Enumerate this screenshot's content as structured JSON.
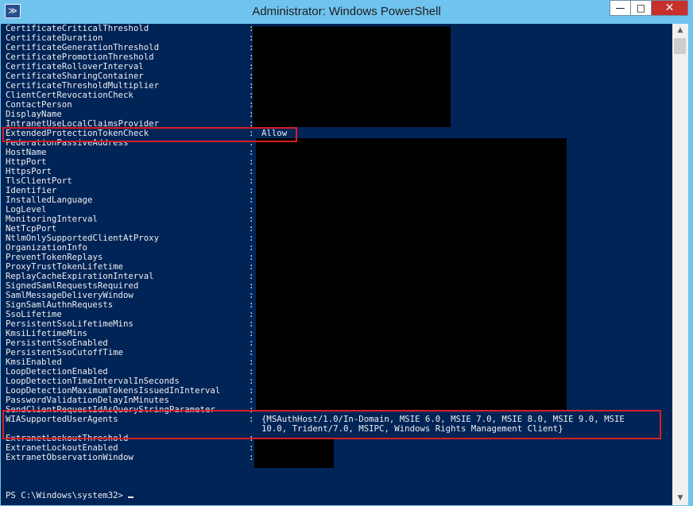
{
  "window": {
    "title": "Administrator: Windows PowerShell",
    "app_icon": "powershell-icon",
    "app_icon_glyph": "≫",
    "controls": {
      "minimize": "—",
      "maximize": "□",
      "close": "✕"
    }
  },
  "console": {
    "lines": [
      {
        "label": "CertificateCriticalThreshold",
        "sep": ":",
        "value": ""
      },
      {
        "label": "CertificateDuration",
        "sep": ":",
        "value": ""
      },
      {
        "label": "CertificateGenerationThreshold",
        "sep": ":",
        "value": ""
      },
      {
        "label": "CertificatePromotionThreshold",
        "sep": ":",
        "value": ""
      },
      {
        "label": "CertificateRolloverInterval",
        "sep": ":",
        "value": ""
      },
      {
        "label": "CertificateSharingContainer",
        "sep": ":",
        "value": ""
      },
      {
        "label": "CertificateThresholdMultiplier",
        "sep": ":",
        "value": ""
      },
      {
        "label": "ClientCertRevocationCheck",
        "sep": ":",
        "value": ""
      },
      {
        "label": "ContactPerson",
        "sep": ":",
        "value": ""
      },
      {
        "label": "DisplayName",
        "sep": ":",
        "value": ""
      },
      {
        "label": "IntranetUseLocalClaimsProvider",
        "sep": ":",
        "value": ""
      },
      {
        "label": "ExtendedProtectionTokenCheck",
        "sep": ":",
        "value": "Allow"
      },
      {
        "label": "FederationPassiveAddress",
        "sep": ":",
        "value": ""
      },
      {
        "label": "HostName",
        "sep": ":",
        "value": ""
      },
      {
        "label": "HttpPort",
        "sep": ":",
        "value": ""
      },
      {
        "label": "HttpsPort",
        "sep": ":",
        "value": ""
      },
      {
        "label": "TlsClientPort",
        "sep": ":",
        "value": ""
      },
      {
        "label": "Identifier",
        "sep": ":",
        "value": ""
      },
      {
        "label": "InstalledLanguage",
        "sep": ":",
        "value": ""
      },
      {
        "label": "LogLevel",
        "sep": ":",
        "value": ""
      },
      {
        "label": "MonitoringInterval",
        "sep": ":",
        "value": ""
      },
      {
        "label": "NetTcpPort",
        "sep": ":",
        "value": ""
      },
      {
        "label": "NtlmOnlySupportedClientAtProxy",
        "sep": ":",
        "value": ""
      },
      {
        "label": "OrganizationInfo",
        "sep": ":",
        "value": ""
      },
      {
        "label": "PreventTokenReplays",
        "sep": ":",
        "value": ""
      },
      {
        "label": "ProxyTrustTokenLifetime",
        "sep": ":",
        "value": ""
      },
      {
        "label": "ReplayCacheExpirationInterval",
        "sep": ":",
        "value": ""
      },
      {
        "label": "SignedSamlRequestsRequired",
        "sep": ":",
        "value": ""
      },
      {
        "label": "SamlMessageDeliveryWindow",
        "sep": ":",
        "value": ""
      },
      {
        "label": "SignSamlAuthnRequests",
        "sep": ":",
        "value": ""
      },
      {
        "label": "SsoLifetime",
        "sep": ":",
        "value": ""
      },
      {
        "label": "PersistentSsoLifetimeMins",
        "sep": ":",
        "value": ""
      },
      {
        "label": "KmsiLifetimeMins",
        "sep": ":",
        "value": ""
      },
      {
        "label": "PersistentSsoEnabled",
        "sep": ":",
        "value": ""
      },
      {
        "label": "PersistentSsoCutoffTime",
        "sep": ":",
        "value": ""
      },
      {
        "label": "KmsiEnabled",
        "sep": ":",
        "value": ""
      },
      {
        "label": "LoopDetectionEnabled",
        "sep": ":",
        "value": ""
      },
      {
        "label": "LoopDetectionTimeIntervalInSeconds",
        "sep": ":",
        "value": ""
      },
      {
        "label": "LoopDetectionMaximumTokensIssuedInInterval",
        "sep": ":",
        "value": ""
      },
      {
        "label": "PasswordValidationDelayInMinutes",
        "sep": ":",
        "value": ""
      },
      {
        "label": "SendClientRequestIdAsQueryStringParameter",
        "sep": ":",
        "value": ""
      },
      {
        "label": "WIASupportedUserAgents",
        "sep": ":",
        "value": "{MSAuthHost/1.0/In-Domain, MSIE 6.0, MSIE 7.0, MSIE 8.0, MSIE 9.0, MSIE"
      },
      {
        "label": "",
        "sep": "",
        "value": "10.0, Trident/7.0, MSIPC, Windows Rights Management Client}"
      },
      {
        "label": "ExtranetLockoutThreshold",
        "sep": ":",
        "value": ""
      },
      {
        "label": "ExtranetLockoutEnabled",
        "sep": ":",
        "value": ""
      },
      {
        "label": "ExtranetObservationWindow",
        "sep": ":",
        "value": ""
      }
    ],
    "prompt": "PS C:\\Windows\\system32>"
  },
  "scrollbar": {
    "up": "▲",
    "down": "▼"
  },
  "colors": {
    "console_bg": "#012456",
    "console_text": "#eeedf0",
    "highlight": "#d61e24",
    "chrome": "#6fc3ee"
  }
}
